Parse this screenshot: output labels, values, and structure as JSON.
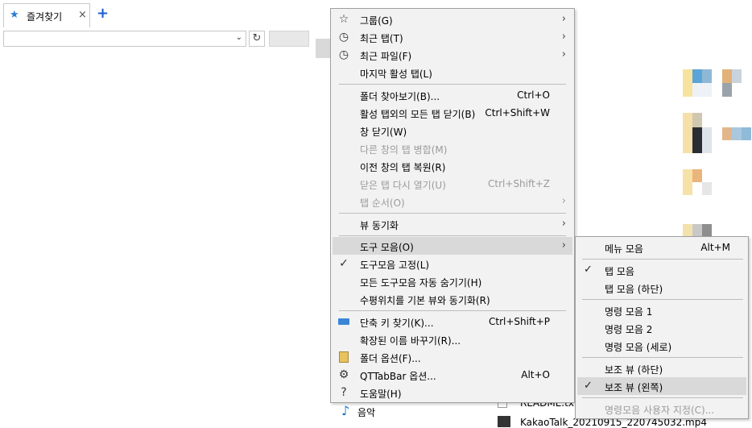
{
  "tab": {
    "label": "즐겨찾기",
    "close": "×",
    "new_tab": "+"
  },
  "address": {
    "value": "",
    "dropdown_glyph": "⌄",
    "refresh_glyph": "↻"
  },
  "files": {
    "item1": "README.txt",
    "item2": "KakaoTalk_20210915_220745032.mp4",
    "music": "음악"
  },
  "menu": {
    "items": [
      {
        "label": "그룹(G)",
        "shortcut": "",
        "submenu": true,
        "icon": "star-icon",
        "disabled": false
      },
      {
        "label": "최근 탭(T)",
        "shortcut": "",
        "submenu": true,
        "icon": "clock-icon",
        "disabled": false
      },
      {
        "label": "최근 파일(F)",
        "shortcut": "",
        "submenu": true,
        "icon": "clock-icon",
        "disabled": false
      },
      {
        "label": "마지막 활성 탭(L)",
        "shortcut": "",
        "submenu": false,
        "icon": "",
        "disabled": false
      },
      {
        "label": "폴더 찾아보기(B)...",
        "shortcut": "Ctrl+O",
        "submenu": false,
        "icon": "",
        "disabled": false
      },
      {
        "label": "활성 탭외의 모든 탭 닫기(B)",
        "shortcut": "Ctrl+Shift+W",
        "submenu": false,
        "icon": "",
        "disabled": false
      },
      {
        "label": "창 닫기(W)",
        "shortcut": "",
        "submenu": false,
        "icon": "",
        "disabled": false
      },
      {
        "label": "다른 창의 탭 병합(M)",
        "shortcut": "",
        "submenu": false,
        "icon": "",
        "disabled": true
      },
      {
        "label": "이전 창의 탭 복원(R)",
        "shortcut": "",
        "submenu": false,
        "icon": "",
        "disabled": false
      },
      {
        "label": "닫은 탭 다시 열기(U)",
        "shortcut": "Ctrl+Shift+Z",
        "submenu": false,
        "icon": "",
        "disabled": true
      },
      {
        "label": "탭 순서(O)",
        "shortcut": "",
        "submenu": true,
        "icon": "",
        "disabled": true
      },
      {
        "label": "뷰 동기화",
        "shortcut": "",
        "submenu": true,
        "icon": "",
        "disabled": false
      },
      {
        "label": "도구 모음(O)",
        "shortcut": "",
        "submenu": true,
        "icon": "",
        "disabled": false,
        "highlighted": true
      },
      {
        "label": "도구모음 고정(L)",
        "shortcut": "",
        "submenu": false,
        "icon": "check-icon",
        "disabled": false
      },
      {
        "label": "모든 도구모음 자동 숨기기(H)",
        "shortcut": "",
        "submenu": false,
        "icon": "",
        "disabled": false
      },
      {
        "label": "수평위치를 기본 뷰와 동기화(R)",
        "shortcut": "",
        "submenu": false,
        "icon": "",
        "disabled": false
      },
      {
        "label": "단축 키 찾기(K)...",
        "shortcut": "Ctrl+Shift+P",
        "submenu": false,
        "icon": "keyboard-icon",
        "disabled": false
      },
      {
        "label": "확장된 이름 바꾸기(R)...",
        "shortcut": "",
        "submenu": false,
        "icon": "",
        "disabled": false
      },
      {
        "label": "폴더 옵션(F)...",
        "shortcut": "",
        "submenu": false,
        "icon": "folder-options-icon",
        "disabled": false
      },
      {
        "label": "QTTabBar 옵션...",
        "shortcut": "Alt+O",
        "submenu": false,
        "icon": "gear-icon",
        "disabled": false
      },
      {
        "label": "도움말(H)",
        "shortcut": "",
        "submenu": false,
        "icon": "help-icon",
        "disabled": false
      }
    ]
  },
  "submenu": {
    "items": [
      {
        "label": "메뉴 모음",
        "shortcut": "Alt+M",
        "checked": false,
        "disabled": false
      },
      {
        "label": "탭 모음",
        "shortcut": "",
        "checked": true,
        "disabled": false
      },
      {
        "label": "탭 모음 (하단)",
        "shortcut": "",
        "checked": false,
        "disabled": false
      },
      {
        "label": "명령 모음 1",
        "shortcut": "",
        "checked": false,
        "disabled": false
      },
      {
        "label": "명령 모음 2",
        "shortcut": "",
        "checked": false,
        "disabled": false
      },
      {
        "label": "명령 모음 (세로)",
        "shortcut": "",
        "checked": false,
        "disabled": false
      },
      {
        "label": "보조 뷰 (하단)",
        "shortcut": "",
        "checked": false,
        "disabled": false
      },
      {
        "label": "보조 뷰 (왼쪽)",
        "shortcut": "",
        "checked": true,
        "disabled": false,
        "highlighted": true
      },
      {
        "label": "명령모음 사용자 지정(C)...",
        "shortcut": "",
        "checked": false,
        "disabled": true
      }
    ]
  },
  "glyphs": {
    "submenu_arrow": "›",
    "check": "✓"
  }
}
